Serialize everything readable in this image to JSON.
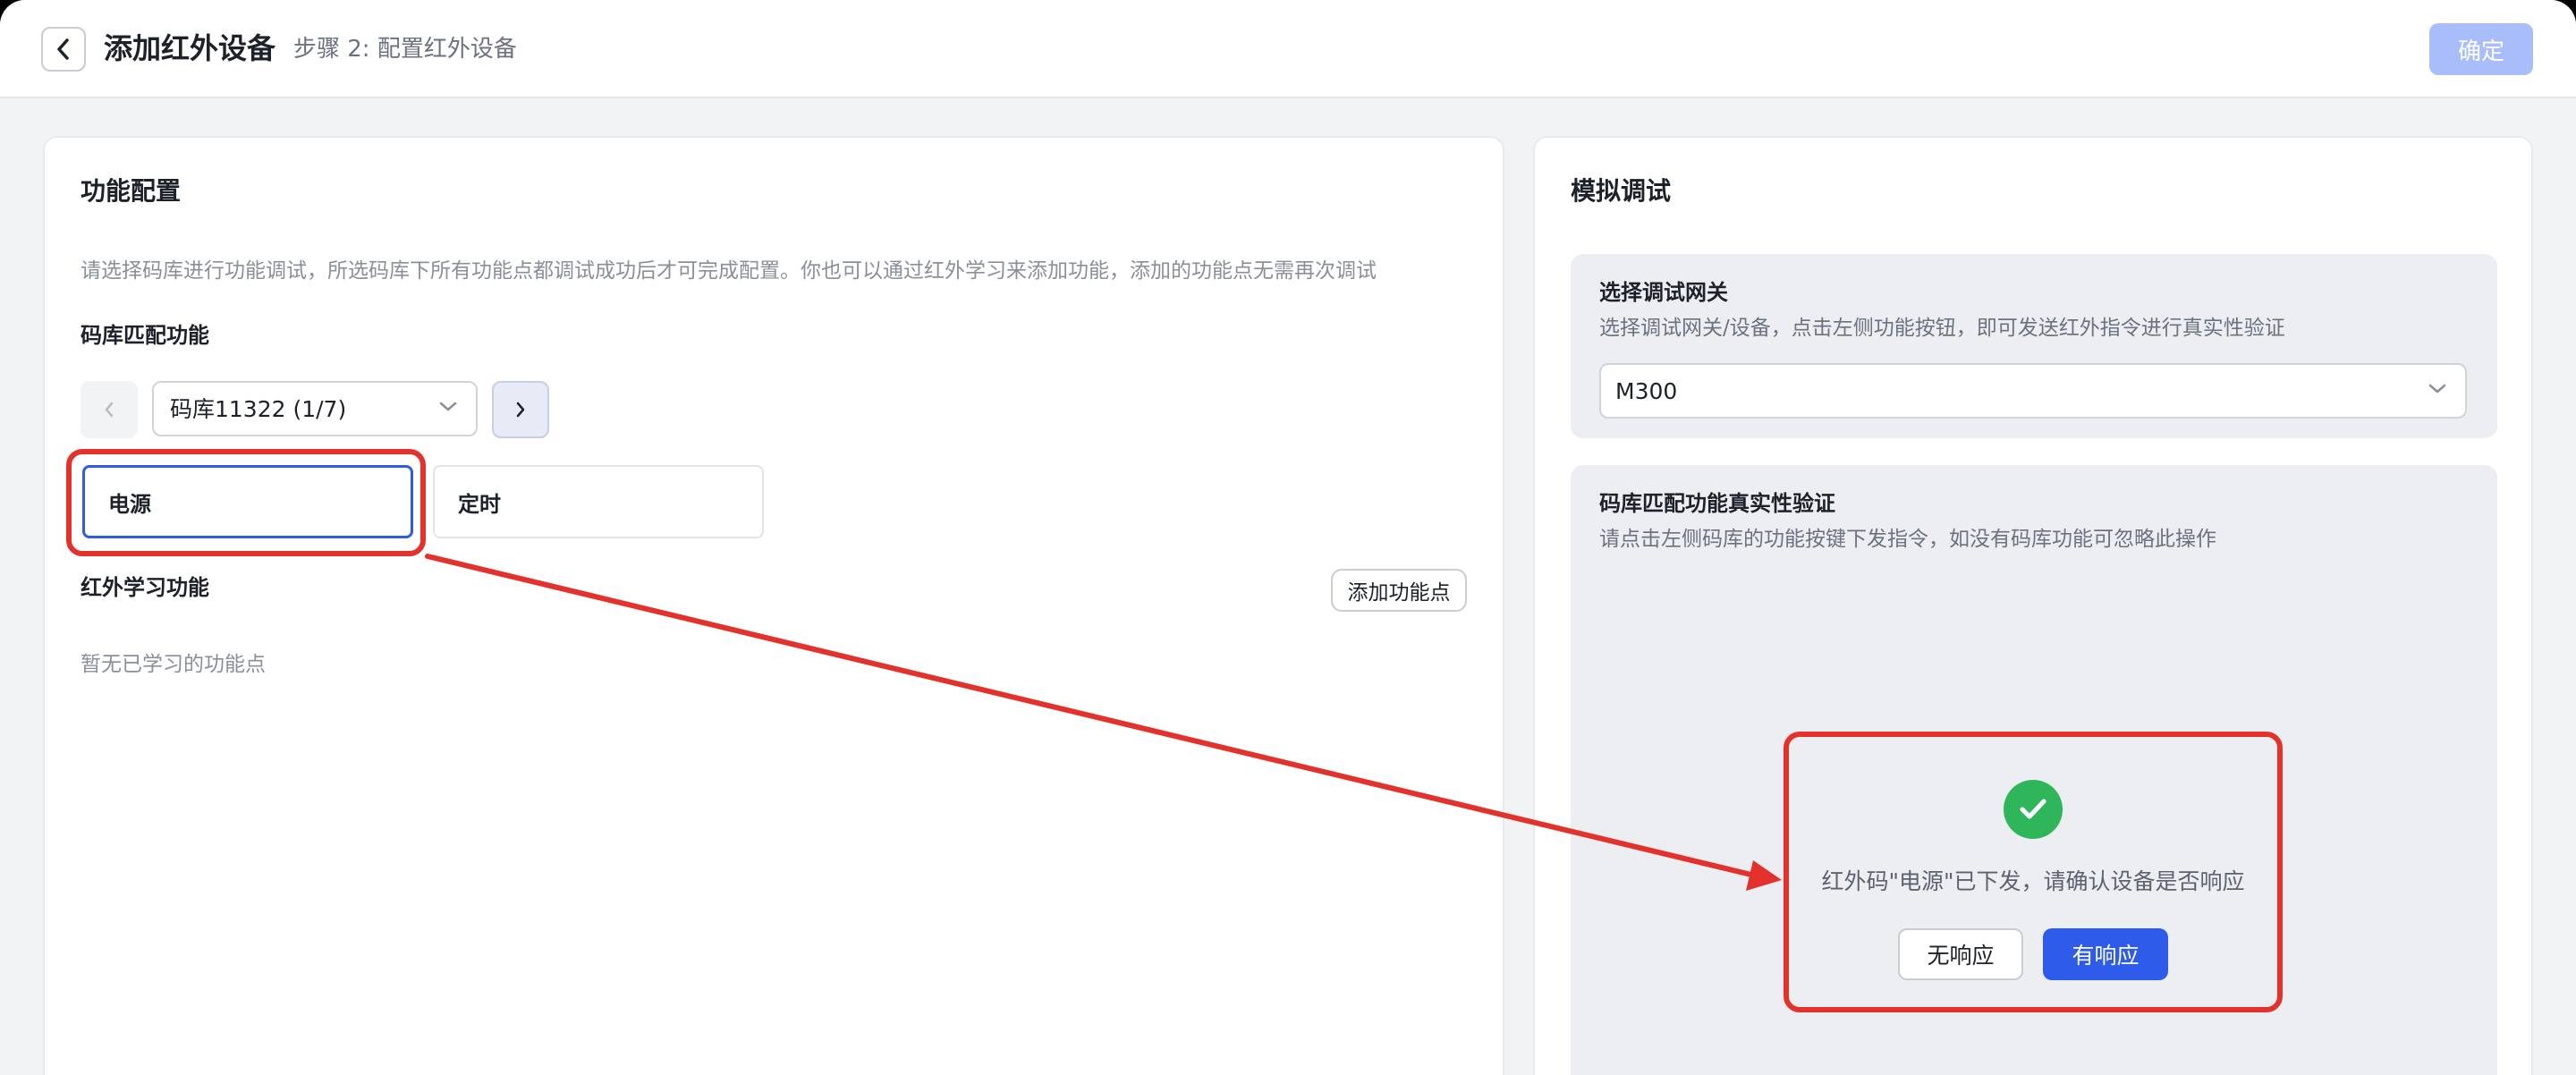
{
  "header": {
    "title": "添加红外设备",
    "subtitle": "步骤 2: 配置红外设备",
    "confirm_label": "确定"
  },
  "left_panel": {
    "title": "功能配置",
    "hint": "请选择码库进行功能调试，所选码库下所有功能点都调试成功后才可完成配置。你也可以通过红外学习来添加功能，添加的功能点无需再次调试",
    "library_section_title": "码库匹配功能",
    "library_select_value": "码库11322 (1/7)",
    "functions": [
      {
        "label": "电源",
        "selected": true
      },
      {
        "label": "定时",
        "selected": false
      }
    ],
    "learn_section_title": "红外学习功能",
    "add_function_label": "添加功能点",
    "learn_empty_text": "暂无已学习的功能点"
  },
  "right_panel": {
    "title": "模拟调试",
    "gateway": {
      "title": "选择调试网关",
      "hint": "选择调试网关/设备，点击左侧功能按钮，即可发送红外指令进行真实性验证",
      "selected_value": "M300"
    },
    "verify": {
      "title": "码库匹配功能真实性验证",
      "hint": "请点击左侧码库的功能按键下发指令，如没有码库功能可忽略此操作",
      "message": "红外码\"电源\"已下发，请确认设备是否响应",
      "no_response_label": "无响应",
      "response_label": "有响应"
    }
  },
  "colors": {
    "primary": "#2f5bea",
    "primary_disabled": "#a8bdf9",
    "success": "#2fb65a",
    "annotation_red": "#e3312b"
  },
  "icons": {
    "back": "chevron-left-icon",
    "prev": "chevron-left-icon",
    "next": "chevron-right-icon",
    "dropdown": "chevron-down-icon",
    "success": "check-circle-icon"
  }
}
